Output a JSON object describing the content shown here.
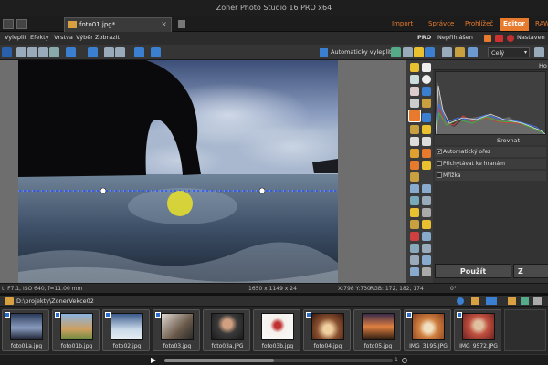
{
  "window": {
    "title": "Zoner Photo Studio 16 PRO x64"
  },
  "tabs": {
    "document": "foto01.jpg*",
    "modes": [
      "Import",
      "Správce",
      "Prohlížeč",
      "Editor",
      "RAW"
    ],
    "active_mode": "Editor",
    "accent": "#e87a2d"
  },
  "menu": {
    "items": [
      "Vyleplit",
      "Efekty",
      "Vrstva",
      "Výběr",
      "Zobrazit"
    ],
    "right": {
      "edition": "PRO",
      "login": "Nepřihlášen",
      "settings": "Nastaven"
    }
  },
  "toolbar": {
    "auto_level": "Automaticky vyleplit",
    "zoom_select": "Celý"
  },
  "right_panel": {
    "header_partial": "Ho",
    "straighten_label": "Srovnat",
    "options": [
      {
        "label": "Automatický ořez",
        "checked": true
      },
      {
        "label": "Přichytávat ke hranám",
        "checked": false
      },
      {
        "label": "Mřížka",
        "checked": false
      }
    ],
    "apply_button": "Použít",
    "second_button_partial": "Z"
  },
  "status": {
    "exif": "t, F7.1, ISO 640, f=11.00 mm",
    "dimensions": "1650 x 1149 x 24",
    "coords": "X:798 Y:730",
    "rgb": "RGB: 172, 182, 174",
    "angle": "0°"
  },
  "path": {
    "value": "D:\\projekty\\ZonerVekce02"
  },
  "filmstrip": {
    "items": [
      {
        "name": "foto01a.jpg",
        "color": "#4a6a8a"
      },
      {
        "name": "foto01b.jpg",
        "color": "#c08a4a"
      },
      {
        "name": "foto02.jpg",
        "color": "#6a8aa8"
      },
      {
        "name": "foto03.jpg",
        "color": "#8a7a6a"
      },
      {
        "name": "foto03a.JPG",
        "color": "#3a3a3a"
      },
      {
        "name": "foto03b.jpg",
        "color": "#e8e4e0"
      },
      {
        "name": "foto04.jpg",
        "color": "#8a5030"
      },
      {
        "name": "foto05.jpg",
        "color": "#c06830"
      },
      {
        "name": "IMG_3195.JPG",
        "color": "#c07040"
      },
      {
        "name": "IMG_9572.JPG",
        "color": "#b84a3a"
      }
    ]
  },
  "playbar": {
    "page": "1"
  }
}
